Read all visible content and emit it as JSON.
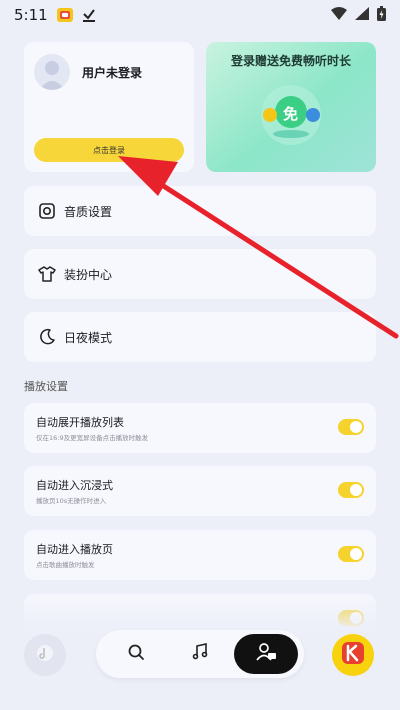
{
  "status_bar": {
    "time": "5:11",
    "icons": [
      "app-notification-icon",
      "download-check-icon",
      "wifi-icon",
      "signal-icon",
      "battery-icon"
    ]
  },
  "profile": {
    "user_status": "用户未登录",
    "login_button": "点击登录"
  },
  "promo": {
    "title": "登录赠送免费畅听时长",
    "badge": "免"
  },
  "menu": [
    {
      "label": "音质设置",
      "icon": "camera-quality-icon"
    },
    {
      "label": "装扮中心",
      "icon": "tshirt-icon"
    },
    {
      "label": "日夜模式",
      "icon": "moon-icon"
    }
  ],
  "playback": {
    "section_title": "播放设置",
    "settings": [
      {
        "title": "自动展开播放列表",
        "desc": "仅在16:9及更宽屏设备点击播放时触发",
        "on": true
      },
      {
        "title": "自动进入沉浸式",
        "desc": "播放页10s无操作时进入",
        "on": true
      },
      {
        "title": "自动进入播放页",
        "desc": "点击歌曲播放时触发",
        "on": true
      },
      {
        "title": "",
        "desc": "",
        "on": true
      }
    ]
  },
  "bottom_nav": {
    "tabs": [
      "search-icon",
      "music-note-icon",
      "profile-icon"
    ],
    "active": "profile-icon"
  },
  "colors": {
    "accent": "#f7d63a",
    "background": "#eceef8",
    "card": "#f7f8fd",
    "arrow": "#e8222b"
  }
}
